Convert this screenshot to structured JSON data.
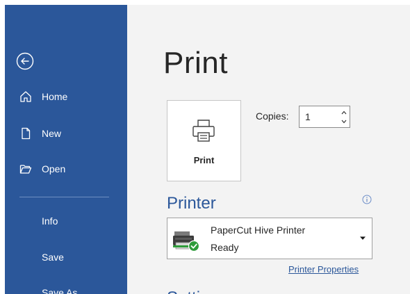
{
  "sidebar": {
    "back_icon": "circle-arrow-left-icon",
    "items": [
      {
        "label": "Home",
        "icon": "home-icon"
      },
      {
        "label": "New",
        "icon": "new-document-icon"
      },
      {
        "label": "Open",
        "icon": "open-folder-icon"
      },
      {
        "label": "Info"
      },
      {
        "label": "Save"
      },
      {
        "label": "Save As"
      }
    ]
  },
  "main": {
    "title": "Print",
    "print_button": {
      "label": "Print",
      "icon": "printer-icon"
    },
    "copies": {
      "label": "Copies:",
      "value": "1"
    },
    "printer_section": {
      "heading": "Printer",
      "info_icon": "info-icon",
      "selected_printer": {
        "name": "PaperCut Hive Printer",
        "status": "Ready",
        "icon": "printer-ready-icon"
      },
      "properties_link": "Printer Properties"
    },
    "next_section_heading": "Settings"
  },
  "colors": {
    "sidebar_bg": "#2b579a",
    "main_bg": "#f3f3f3",
    "accent": "#2b579a",
    "status_ok": "#2e9b3a"
  }
}
